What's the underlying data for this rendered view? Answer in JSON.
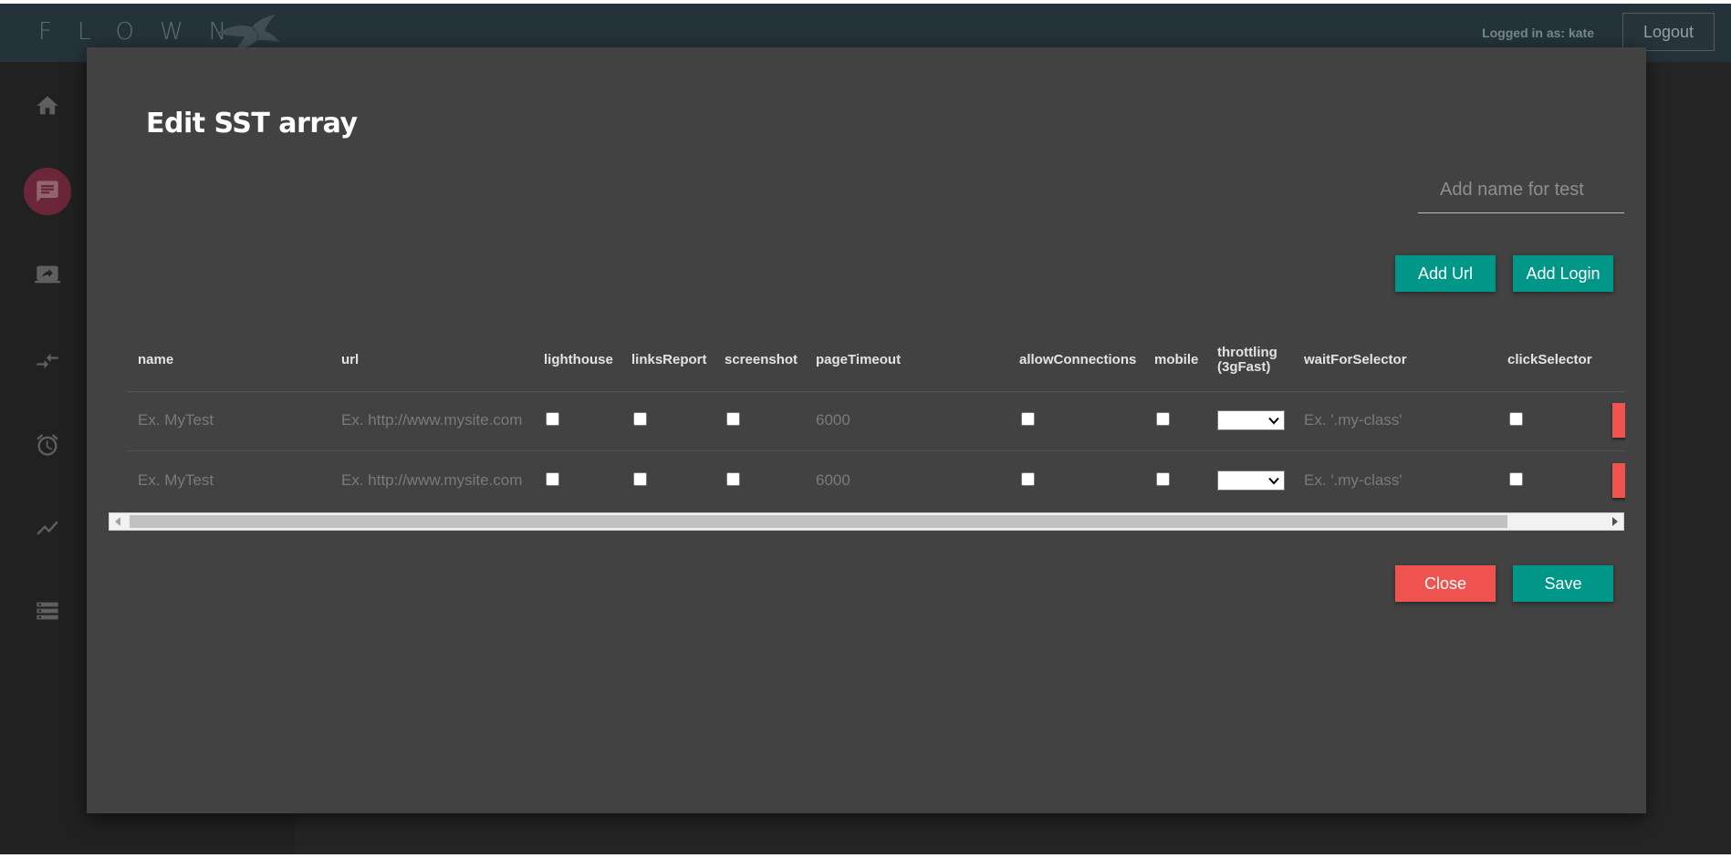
{
  "header": {
    "brand": "FLOWN",
    "logged_in": "Logged in as: kate",
    "logout": "Logout"
  },
  "sidebar": {
    "icons": [
      "home-icon",
      "chat-icon",
      "screen-share-icon",
      "merge-arrows-icon",
      "alarm-icon",
      "trending-icon",
      "storage-icon"
    ],
    "active_index": 1
  },
  "modal": {
    "title": "Edit SST array",
    "name_placeholder": "Add name for test",
    "add_url": "Add Url",
    "add_login": "Add Login",
    "close": "Close",
    "save": "Save"
  },
  "table": {
    "columns": [
      "name",
      "url",
      "lighthouse",
      "linksReport",
      "screenshot",
      "pageTimeout",
      "allowConnections",
      "mobile",
      "throttling (3gFast)",
      "waitForSelector",
      "clickSelector"
    ],
    "rows": [
      {
        "name_placeholder": "Ex. MyTest",
        "url_placeholder": "Ex. http://www.mysite.com",
        "lighthouse": false,
        "linksReport": false,
        "screenshot": false,
        "pageTimeout_placeholder": "6000",
        "allowConnections": false,
        "mobile": false,
        "throttling": "",
        "waitForSelector_placeholder": "Ex. '.my-class'",
        "clickSelector": false
      },
      {
        "name_placeholder": "Ex. MyTest",
        "url_placeholder": "Ex. http://www.mysite.com",
        "lighthouse": false,
        "linksReport": false,
        "screenshot": false,
        "pageTimeout_placeholder": "6000",
        "allowConnections": false,
        "mobile": false,
        "throttling": "",
        "waitForSelector_placeholder": "Ex. '.my-class'",
        "clickSelector": false
      }
    ]
  },
  "colors": {
    "teal": "#009688",
    "red": "#ef5350",
    "modal_bg": "#424242",
    "header_bg": "#2a3b42"
  }
}
